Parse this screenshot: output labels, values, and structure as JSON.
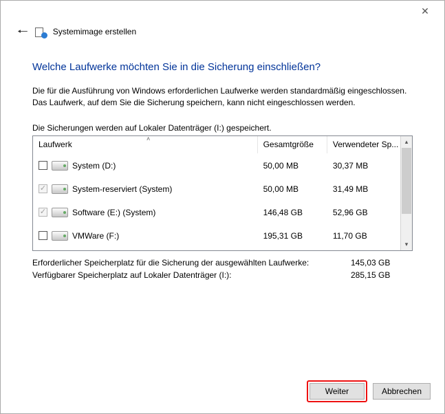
{
  "titlebar": {
    "close_tooltip": "Close"
  },
  "header": {
    "app_title": "Systemimage erstellen"
  },
  "main": {
    "heading": "Welche Laufwerke möchten Sie in die Sicherung einschließen?",
    "description": "Die für die Ausführung von Windows erforderlichen Laufwerke werden standardmäßig eingeschlossen. Das Laufwerk, auf dem Sie die Sicherung speichern, kann nicht eingeschlossen werden.",
    "save_location": "Die Sicherungen werden auf Lokaler Datenträger (I:) gespeichert."
  },
  "columns": {
    "drive": "Laufwerk",
    "total": "Gesamtgröße",
    "used": "Verwendeter Sp..."
  },
  "drives": [
    {
      "checked": false,
      "disabled": false,
      "name": "System (D:)",
      "total": "50,00 MB",
      "used": "30,37 MB"
    },
    {
      "checked": true,
      "disabled": true,
      "name": "System-reserviert (System)",
      "total": "50,00 MB",
      "used": "31,49 MB"
    },
    {
      "checked": true,
      "disabled": true,
      "name": "Software (E:) (System)",
      "total": "146,48 GB",
      "used": "52,96 GB"
    },
    {
      "checked": false,
      "disabled": false,
      "name": "VMWare (F:)",
      "total": "195,31 GB",
      "used": "11,70 GB"
    }
  ],
  "summary": {
    "required_label": "Erforderlicher Speicherplatz für die Sicherung der ausgewählten Laufwerke:",
    "required_value": "145,03 GB",
    "available_label": "Verfügbarer Speicherplatz auf Lokaler Datenträger (I:):",
    "available_value": "285,15 GB"
  },
  "buttons": {
    "next": "Weiter",
    "cancel": "Abbrechen"
  }
}
